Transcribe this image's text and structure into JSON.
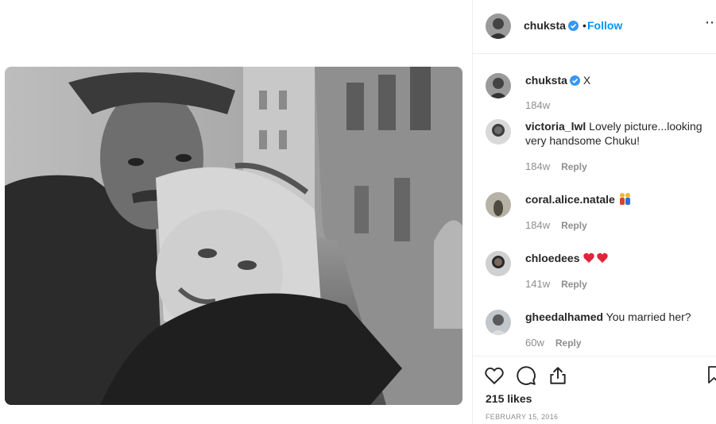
{
  "post": {
    "username": "chuksta",
    "follow_label": "Follow",
    "separator": "•",
    "more_label": "⋯"
  },
  "comments": [
    {
      "user": "chuksta",
      "text": "X",
      "time": "184w",
      "reply": ""
    },
    {
      "user": "victoria_lwl",
      "text": "Lovely picture...looking very handsome Chuku!",
      "time": "184w",
      "reply": "Reply"
    },
    {
      "user": "coral.alice.natale",
      "text": "",
      "time": "184w",
      "reply": "Reply",
      "emoji": "couple-emoji"
    },
    {
      "user": "chloedees",
      "text": "",
      "time": "141w",
      "reply": "Reply",
      "emoji": "two-hearts-emoji"
    },
    {
      "user": "gheedalhamed",
      "text": "You married her?",
      "time": "60w",
      "reply": "Reply"
    }
  ],
  "footer": {
    "likes": "215 likes",
    "date": "FEBRUARY 15, 2016"
  },
  "colors": {
    "accent": "#0095f6",
    "muted": "#8e8e8e",
    "text": "#262626",
    "heart": "#ed4956"
  }
}
